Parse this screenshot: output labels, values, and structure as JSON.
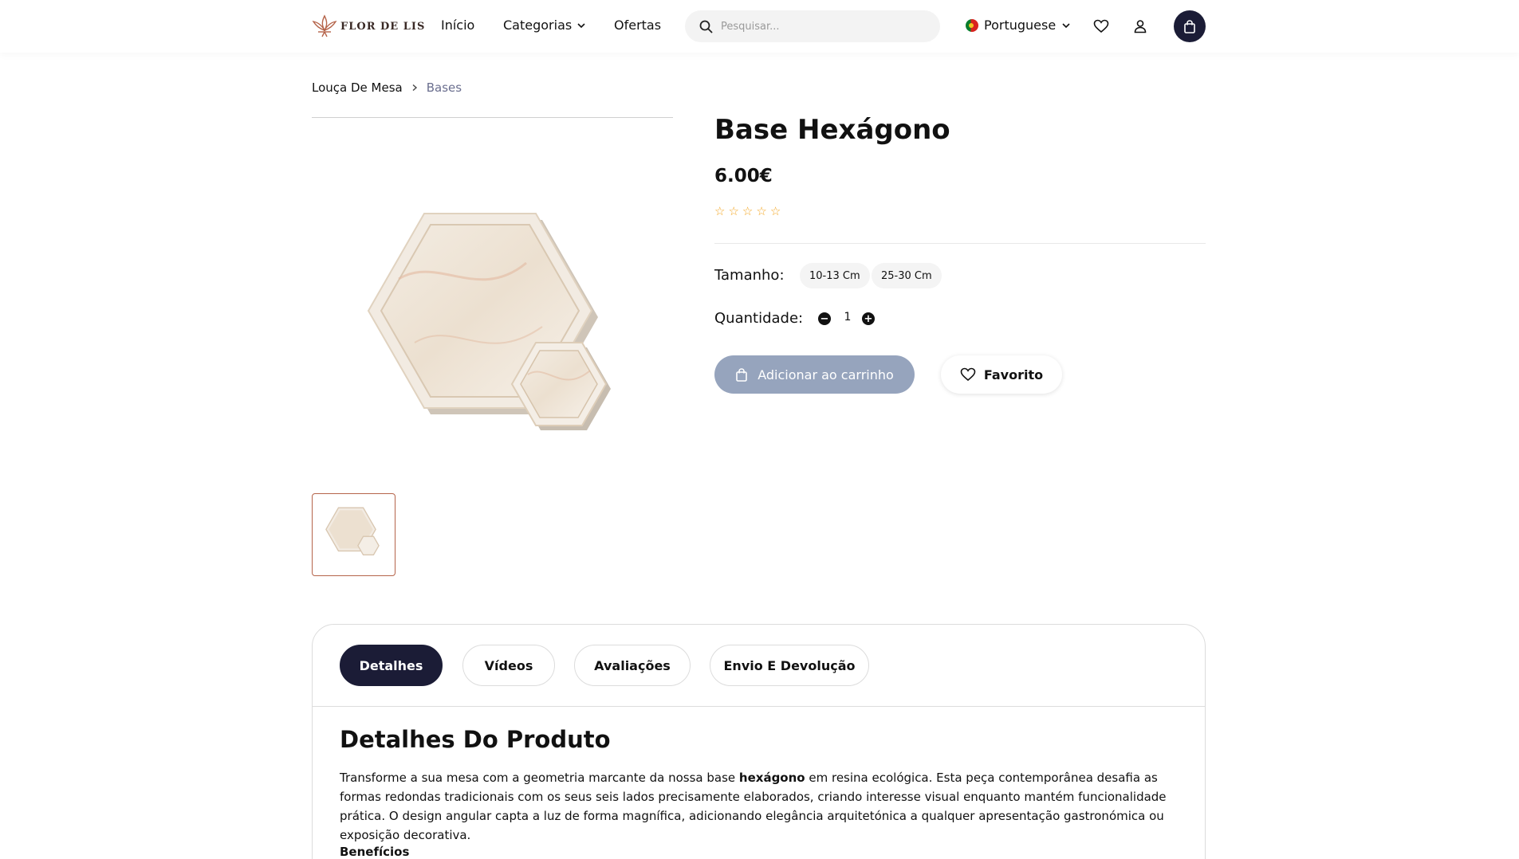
{
  "header": {
    "logo_text": "FLOR DE LIS",
    "nav": {
      "home": "Início",
      "categories": "Categorias",
      "offers": "Ofertas"
    },
    "search_placeholder": "Pesquisar...",
    "language": "Portuguese"
  },
  "breadcrumb": {
    "parent": "Louça De Mesa",
    "current": "Bases"
  },
  "product": {
    "title": "Base Hexágono",
    "price": "6.00€",
    "rating": 0,
    "rating_max": 5,
    "size_label": "Tamanho:",
    "sizes": [
      "10-13 Cm",
      "25-30 Cm"
    ],
    "quantity_label": "Quantidade:",
    "quantity": "1",
    "add_to_cart_label": "Adicionar ao carrinho",
    "favorite_label": "Favorito"
  },
  "tabs": [
    "Detalhes",
    "Vídeos",
    "Avaliações",
    "Envio E Devolução"
  ],
  "details": {
    "title": "Detalhes Do Produto",
    "desc_part1": "Transforme a sua mesa com a geometria marcante da nossa base ",
    "desc_bold": "hexágono",
    "desc_part2": " em resina ecológica. Esta peça contemporânea desafia as formas redondas tradicionais com os seus seis lados precisamente elaborados, criando interesse visual enquanto mantém funcionalidade prática. O design angular capta a luz de forma magnífica, adicionando elegância arquitetónica a qualquer apresentação gastronómica ou exposição decorativa.",
    "benefits_label": "Benefícios"
  },
  "colors": {
    "navy": "#1b1c36",
    "cart_button": "#96a4bd",
    "star": "#f3a622",
    "thumb_border": "#b5644a",
    "breadcrumb_current": "#6b6f8f"
  }
}
